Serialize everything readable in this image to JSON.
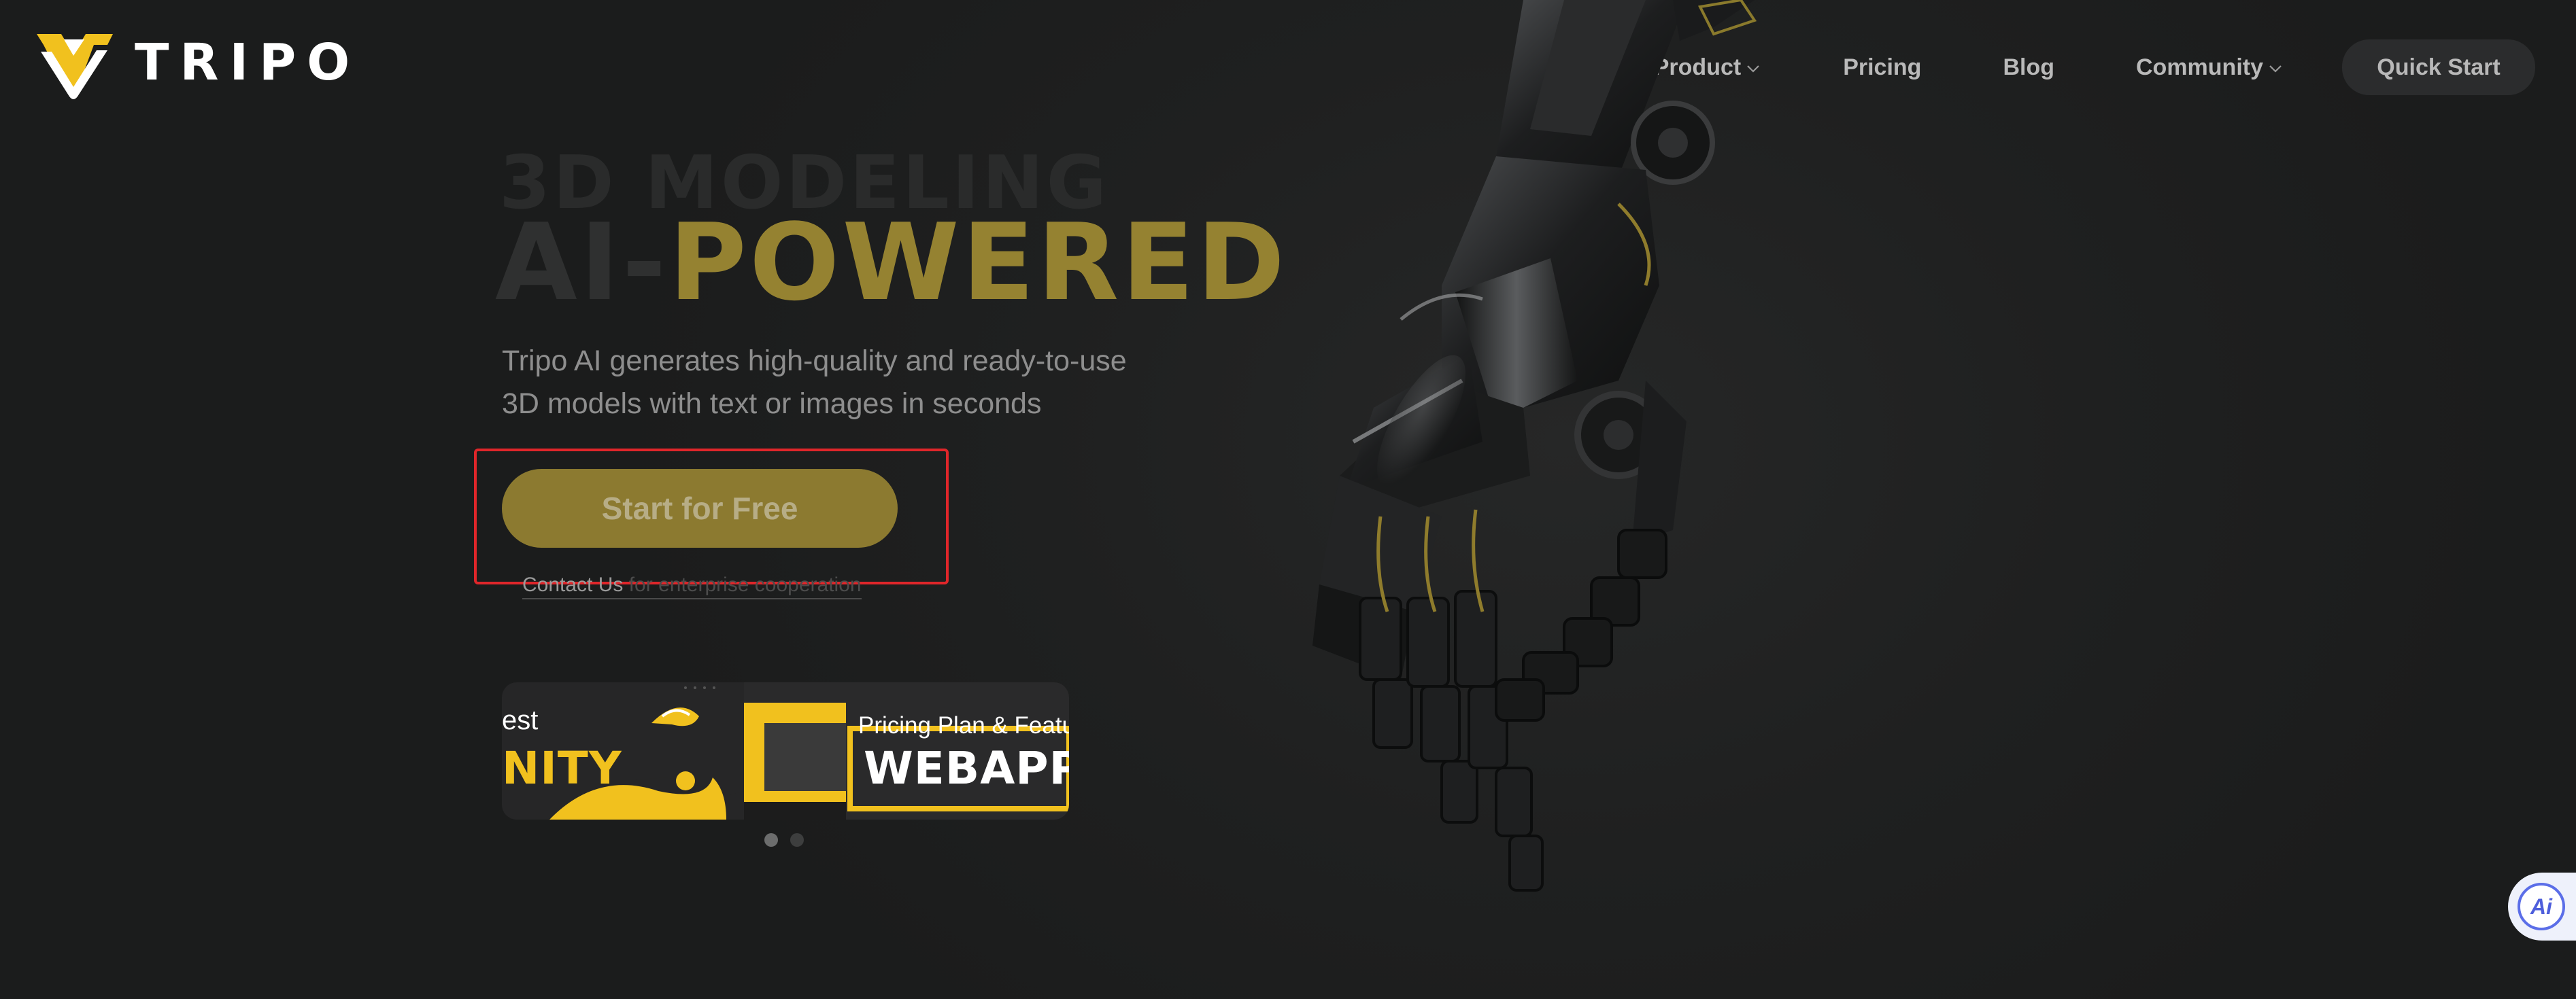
{
  "brand": {
    "name": "TRIPO",
    "accent_color": "#f1c11e",
    "gold_color": "#958231"
  },
  "nav": {
    "items": [
      {
        "label": "Product",
        "has_dropdown": true
      },
      {
        "label": "Pricing",
        "has_dropdown": false
      },
      {
        "label": "Blog",
        "has_dropdown": false
      },
      {
        "label": "Community",
        "has_dropdown": true
      }
    ],
    "cta_label": "Quick Start"
  },
  "hero": {
    "eyebrow": "3D MODELING",
    "title_part_a": "AI-",
    "title_part_b": "POWERED",
    "subtitle_line1": "Tripo AI generates high-quality and ready-to-use",
    "subtitle_line2": "3D models with text or images in seconds",
    "cta_label": "Start for Free",
    "contact_link": "Contact Us",
    "contact_rest": " for enterprise cooperation"
  },
  "carousel": {
    "slide_a": {
      "text_top": "est",
      "text_big": "NITY"
    },
    "slide_b": {
      "text_top": "Pricing Plan & Featu",
      "text_big": "WEBAPP"
    },
    "slide_count": 2,
    "active_index": 0
  },
  "ai_assistant": {
    "label": "Ai",
    "icon": "ai-assistant-icon"
  },
  "highlight_color": "#e0262a"
}
